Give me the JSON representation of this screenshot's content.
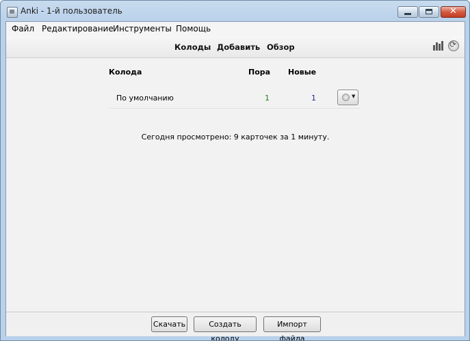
{
  "window": {
    "title": "Anki - 1-й пользователь"
  },
  "menu": {
    "items": [
      "Файл",
      "Редактирование",
      "Инструменты",
      "Помощь"
    ]
  },
  "toolbar": {
    "links": [
      "Колоды",
      "Добавить",
      "Обзор"
    ]
  },
  "decks": {
    "headers": {
      "deck": "Колода",
      "due": "Пора",
      "new": "Новые"
    },
    "rows": [
      {
        "name": "По умолчанию",
        "due": "1",
        "new": "1"
      }
    ]
  },
  "studied_today": "Сегодня просмотрено: 9 карточек за 1 минуту.",
  "bottom": {
    "buttons": [
      "Скачать",
      "Создать колоду",
      "Импорт файла"
    ]
  },
  "colors": {
    "due": "#1d7a1d",
    "new": "#1e1e9c",
    "close_button": "#c13d23"
  }
}
